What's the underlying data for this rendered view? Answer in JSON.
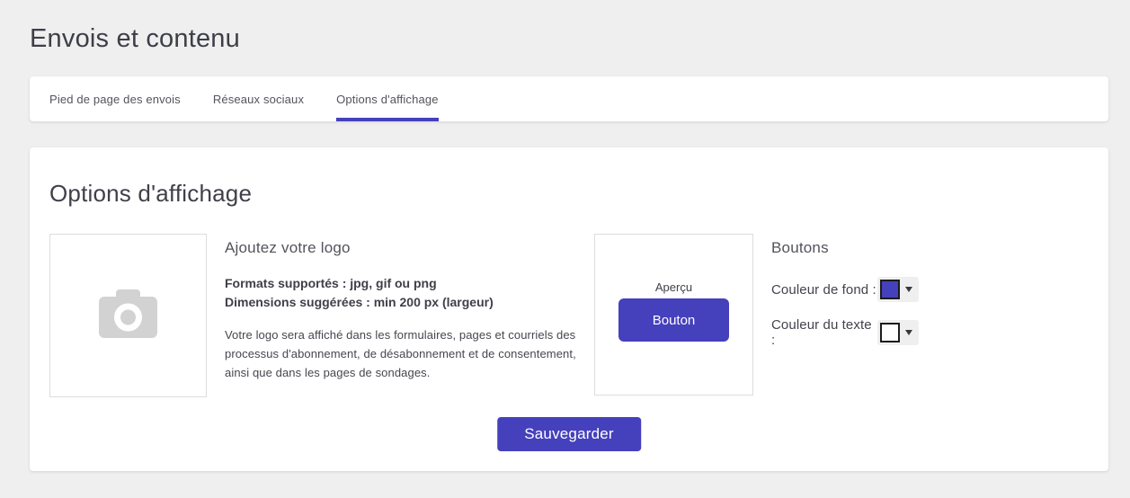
{
  "page": {
    "title": "Envois et contenu",
    "background_color": "#efefef",
    "accent_color": "#4540bc"
  },
  "tabs": [
    {
      "label": "Pied de page des envois",
      "active": false
    },
    {
      "label": "Réseaux sociaux",
      "active": false
    },
    {
      "label": "Options d'affichage",
      "active": true
    }
  ],
  "panel": {
    "title": "Options d'affichage",
    "logo_section": {
      "placeholder_icon": "camera-icon",
      "heading": "Ajoutez votre logo",
      "formats_line": "Formats supportés : jpg, gif ou png",
      "dimensions_line": "Dimensions suggérées : min 200 px (largeur)",
      "description": "Votre logo sera affiché dans les formulaires, pages et courriels des processus d'abonnement, de désabonnement et de consentement, ainsi que dans les pages de sondages."
    },
    "preview_section": {
      "label": "Aperçu",
      "button_label": "Bouton"
    },
    "buttons_section": {
      "heading": "Boutons",
      "background_color_label": "Couleur de fond :",
      "background_color_value": "#4540bc",
      "text_color_label": "Couleur du texte :",
      "text_color_value": "#ffffff"
    },
    "save_button_label": "Sauvegarder"
  }
}
